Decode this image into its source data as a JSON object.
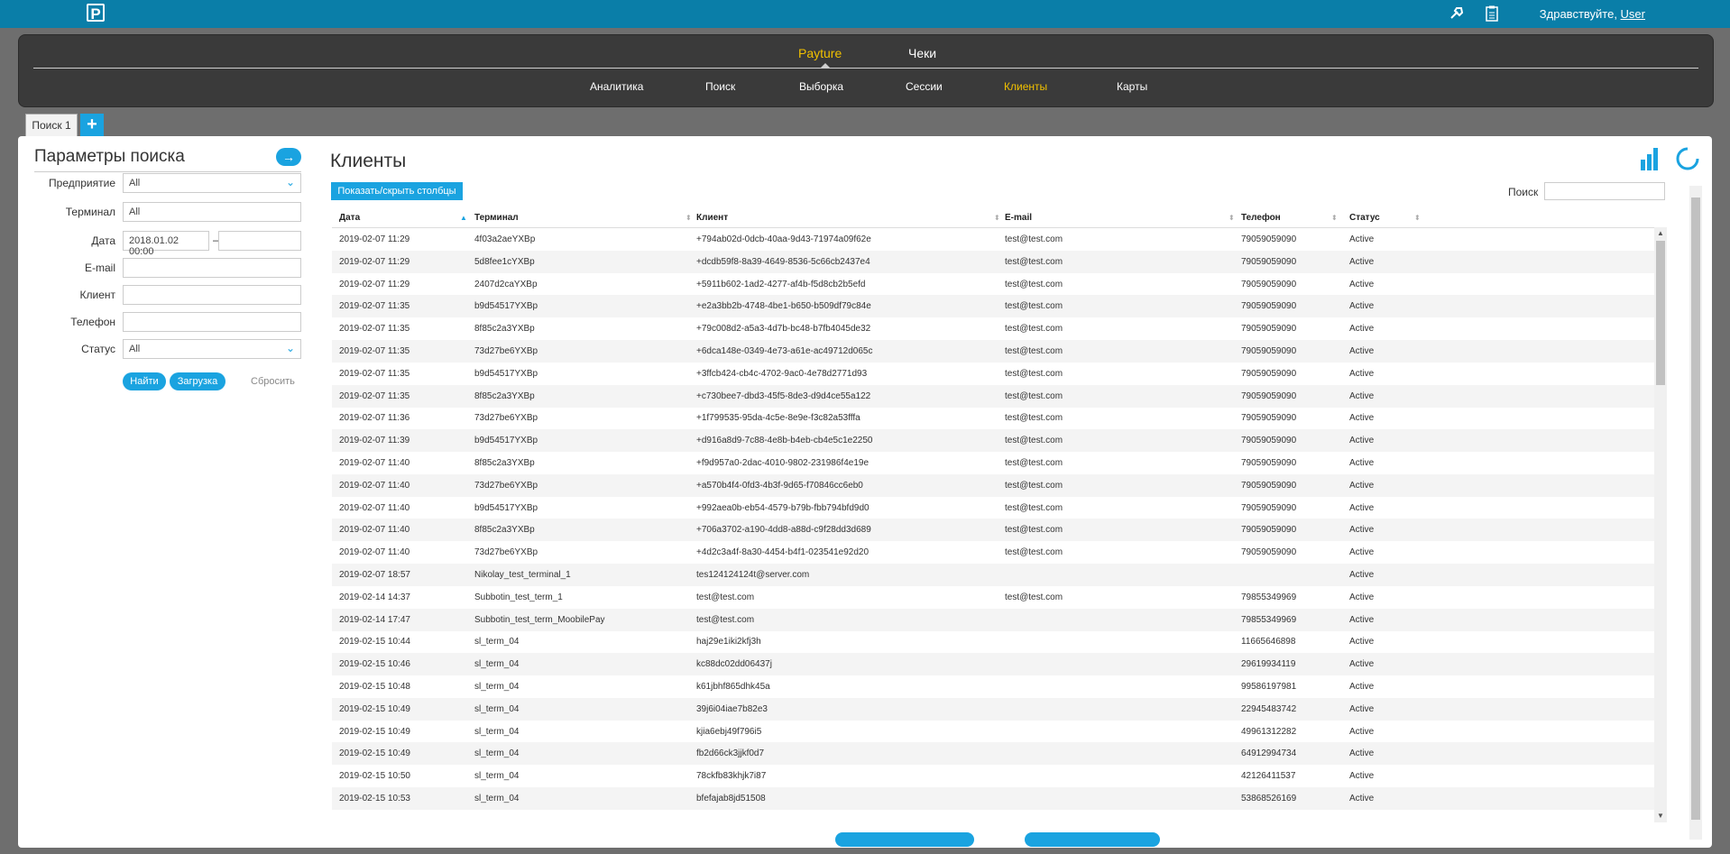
{
  "topbar": {
    "logo_letter": "P",
    "greeting_prefix": "Здравствуйте, ",
    "user": "User"
  },
  "nav": {
    "top": [
      "Payture",
      "Чеки"
    ],
    "active_top": "Payture",
    "sub": [
      "Аналитика",
      "Поиск",
      "Выборка",
      "Сессии",
      "Клиенты",
      "Карты"
    ],
    "active_sub": "Клиенты"
  },
  "tabs": {
    "tab1": "Поиск 1",
    "add": "+"
  },
  "search_panel": {
    "title": "Параметры поиска",
    "go": "→",
    "fields": {
      "enterprise_label": "Предприятие",
      "enterprise_value": "All",
      "terminal_label": "Терминал",
      "terminal_value": "All",
      "date_label": "Дата",
      "date_from": "2018.01.02 00:00",
      "date_dash": "–",
      "email_label": "E-mail",
      "client_label": "Клиент",
      "phone_label": "Телефон",
      "status_label": "Статус",
      "status_value": "All"
    },
    "find_btn": "Найти",
    "load_btn": "Загрузка",
    "reset": "Сбросить"
  },
  "clients": {
    "title": "Клиенты",
    "toggle_cols": "Показать/скрыть столбцы",
    "search_label": "Поиск",
    "columns": [
      "Дата",
      "Терминал",
      "Клиент",
      "E-mail",
      "Телефон",
      "Статус"
    ],
    "rows": [
      [
        "2019-02-07 11:29",
        "4f03a2aeYXBp",
        "+794ab02d-0dcb-40aa-9d43-71974a09f62e",
        "test@test.com",
        "79059059090",
        "Active"
      ],
      [
        "2019-02-07 11:29",
        "5d8fee1cYXBp",
        "+dcdb59f8-8a39-4649-8536-5c66cb2437e4",
        "test@test.com",
        "79059059090",
        "Active"
      ],
      [
        "2019-02-07 11:29",
        "2407d2caYXBp",
        "+5911b602-1ad2-4277-af4b-f5d8cb2b5efd",
        "test@test.com",
        "79059059090",
        "Active"
      ],
      [
        "2019-02-07 11:35",
        "b9d54517YXBp",
        "+e2a3bb2b-4748-4be1-b650-b509df79c84e",
        "test@test.com",
        "79059059090",
        "Active"
      ],
      [
        "2019-02-07 11:35",
        "8f85c2a3YXBp",
        "+79c008d2-a5a3-4d7b-bc48-b7fb4045de32",
        "test@test.com",
        "79059059090",
        "Active"
      ],
      [
        "2019-02-07 11:35",
        "73d27be6YXBp",
        "+6dca148e-0349-4e73-a61e-ac49712d065c",
        "test@test.com",
        "79059059090",
        "Active"
      ],
      [
        "2019-02-07 11:35",
        "b9d54517YXBp",
        "+3ffcb424-cb4c-4702-9ac0-4e78d2771d93",
        "test@test.com",
        "79059059090",
        "Active"
      ],
      [
        "2019-02-07 11:35",
        "8f85c2a3YXBp",
        "+c730bee7-dbd3-45f5-8de3-d9d4ce55a122",
        "test@test.com",
        "79059059090",
        "Active"
      ],
      [
        "2019-02-07 11:36",
        "73d27be6YXBp",
        "+1f799535-95da-4c5e-8e9e-f3c82a53fffa",
        "test@test.com",
        "79059059090",
        "Active"
      ],
      [
        "2019-02-07 11:39",
        "b9d54517YXBp",
        "+d916a8d9-7c88-4e8b-b4eb-cb4e5c1e2250",
        "test@test.com",
        "79059059090",
        "Active"
      ],
      [
        "2019-02-07 11:40",
        "8f85c2a3YXBp",
        "+f9d957a0-2dac-4010-9802-231986f4e19e",
        "test@test.com",
        "79059059090",
        "Active"
      ],
      [
        "2019-02-07 11:40",
        "73d27be6YXBp",
        "+a570b4f4-0fd3-4b3f-9d65-f70846cc6eb0",
        "test@test.com",
        "79059059090",
        "Active"
      ],
      [
        "2019-02-07 11:40",
        "b9d54517YXBp",
        "+992aea0b-eb54-4579-b79b-fbb794bfd9d0",
        "test@test.com",
        "79059059090",
        "Active"
      ],
      [
        "2019-02-07 11:40",
        "8f85c2a3YXBp",
        "+706a3702-a190-4dd8-a88d-c9f28dd3d689",
        "test@test.com",
        "79059059090",
        "Active"
      ],
      [
        "2019-02-07 11:40",
        "73d27be6YXBp",
        "+4d2c3a4f-8a30-4454-b4f1-023541e92d20",
        "test@test.com",
        "79059059090",
        "Active"
      ],
      [
        "2019-02-07 18:57",
        "Nikolay_test_terminal_1",
        "tes124124124t@server.com",
        "",
        "",
        "Active"
      ],
      [
        "2019-02-14 14:37",
        "Subbotin_test_term_1",
        "test@test.com",
        "test@test.com",
        "79855349969",
        "Active"
      ],
      [
        "2019-02-14 17:47",
        "Subbotin_test_term_MoobilePay",
        "test@test.com",
        "",
        "79855349969",
        "Active"
      ],
      [
        "2019-02-15 10:44",
        "sl_term_04",
        "haj29e1iki2kfj3h",
        "",
        "11665646898",
        "Active"
      ],
      [
        "2019-02-15 10:46",
        "sl_term_04",
        "kc88dc02dd06437j",
        "",
        "29619934119",
        "Active"
      ],
      [
        "2019-02-15 10:48",
        "sl_term_04",
        "k61jbhf865dhk45a",
        "",
        "99586197981",
        "Active"
      ],
      [
        "2019-02-15 10:49",
        "sl_term_04",
        "39j6i04iae7b82e3",
        "",
        "22945483742",
        "Active"
      ],
      [
        "2019-02-15 10:49",
        "sl_term_04",
        "kjia6ebj49f796i5",
        "",
        "49961312282",
        "Active"
      ],
      [
        "2019-02-15 10:49",
        "sl_term_04",
        "fb2d66ck3jjkf0d7",
        "",
        "64912994734",
        "Active"
      ],
      [
        "2019-02-15 10:50",
        "sl_term_04",
        "78ckfb83khjk7i87",
        "",
        "42126411537",
        "Active"
      ],
      [
        "2019-02-15 10:53",
        "sl_term_04",
        "bfefajab8jd51508",
        "",
        "53868526169",
        "Active"
      ]
    ]
  }
}
